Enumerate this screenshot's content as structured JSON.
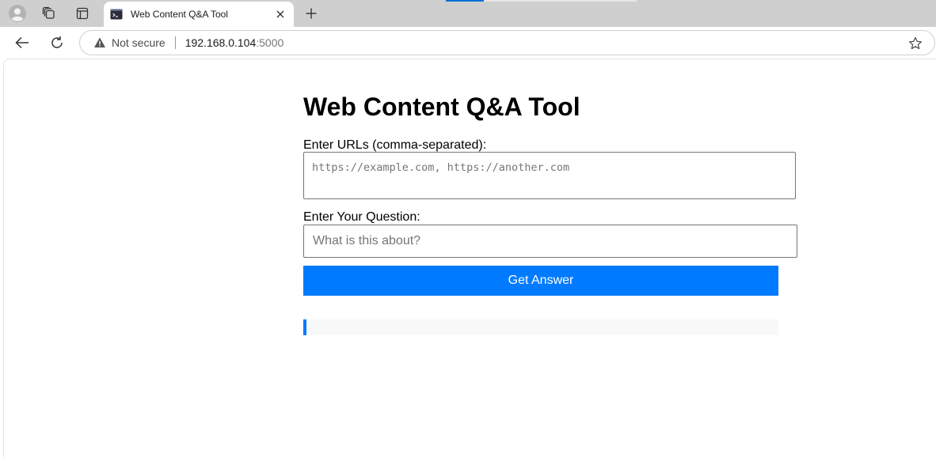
{
  "browser": {
    "tab": {
      "title": "Web Content Q&A Tool"
    },
    "address_bar": {
      "security_text": "Not secure",
      "host": "192.168.0.104",
      "port": ":5000"
    },
    "icons": {
      "profile": "profile-icon",
      "workspaces": "workspaces-icon",
      "tab_actions": "tab-actions-icon",
      "favicon": "terminal-icon",
      "close": "close-icon",
      "new_tab": "plus-icon",
      "back": "back-arrow-icon",
      "reload": "reload-icon",
      "warning": "warning-icon",
      "favorite": "star-icon"
    }
  },
  "page": {
    "title": "Web Content Q&A Tool",
    "urls": {
      "label": "Enter URLs (comma-separated):",
      "value": "",
      "placeholder": "https://example.com, https://another.com"
    },
    "question": {
      "label": "Enter Your Question:",
      "value": "",
      "placeholder": "What is this about?"
    },
    "submit_label": "Get Answer",
    "answer_text": ""
  },
  "colors": {
    "accent": "#007bff",
    "answer_background": "#f8f8f8",
    "tabstrip": "#cfcfcf"
  }
}
